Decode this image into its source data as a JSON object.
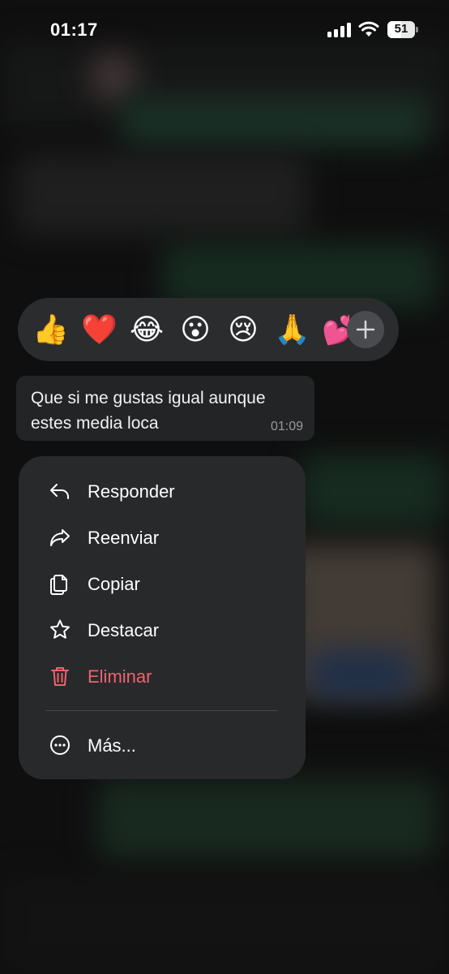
{
  "status_bar": {
    "time": "01:17",
    "battery": "51"
  },
  "reactions": [
    "👍",
    "❤️",
    "😂",
    "😮",
    "😢",
    "🙏",
    "💕"
  ],
  "message": {
    "text": "Que si me gustas igual aunque estes media loca",
    "time": "01:09"
  },
  "menu": {
    "items": [
      {
        "label": "Responder",
        "icon": "reply-icon"
      },
      {
        "label": "Reenviar",
        "icon": "forward-icon"
      },
      {
        "label": "Copiar",
        "icon": "copy-icon"
      },
      {
        "label": "Destacar",
        "icon": "star-icon"
      },
      {
        "label": "Eliminar",
        "icon": "trash-icon"
      },
      {
        "label": "Más...",
        "icon": "more-icon"
      }
    ]
  },
  "colors": {
    "menu_bg": "#28292b",
    "danger": "#f2616e",
    "bubble_bg": "#232425"
  }
}
